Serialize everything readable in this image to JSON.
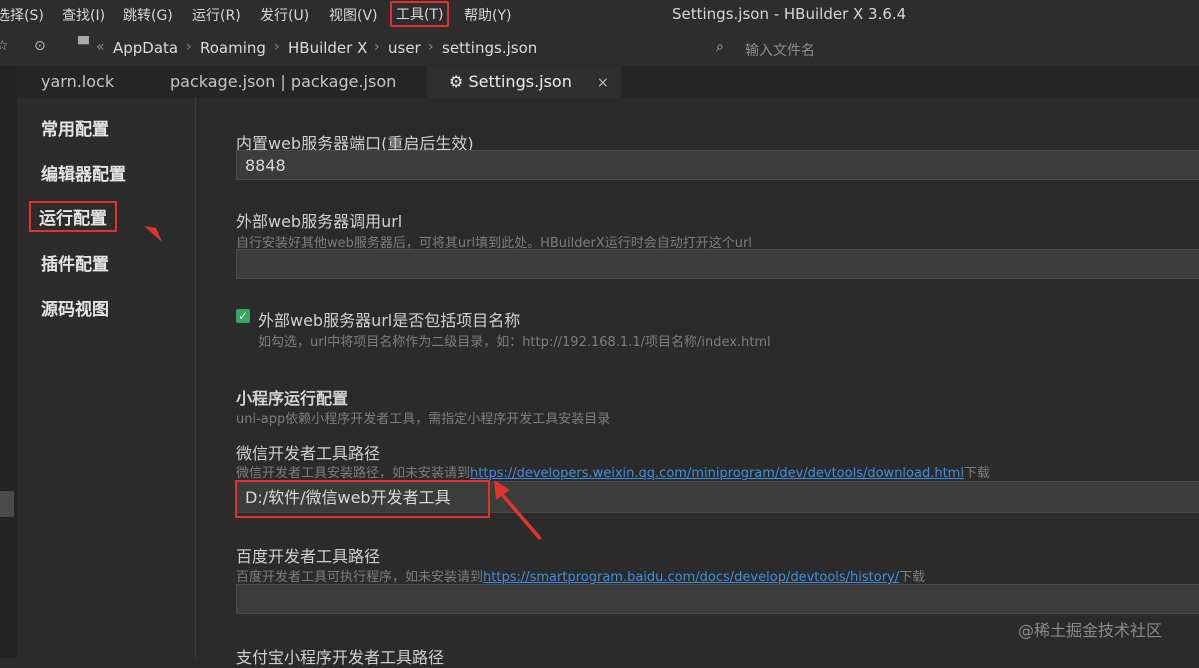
{
  "menubar": {
    "items": [
      "选择(S)",
      "查找(I)",
      "跳转(G)",
      "运行(R)",
      "发行(U)",
      "视图(V)",
      "工具(T)",
      "帮助(Y)"
    ],
    "window_title": "Settings.json - HBuilder X 3.6.4"
  },
  "toolbar": {
    "breadcrumb": [
      "AppData",
      "Roaming",
      "HBuilder X",
      "user",
      "settings.json"
    ],
    "file_search_placeholder": "输入文件名"
  },
  "tabs": [
    {
      "label": "yarn.lock",
      "active": false
    },
    {
      "label": "package.json | package.json",
      "active": false
    },
    {
      "label": "Settings.json",
      "active": true,
      "close": "×"
    }
  ],
  "sidebar": {
    "items": [
      "常用配置",
      "编辑器配置",
      "运行配置",
      "插件配置",
      "源码视图"
    ],
    "selected": "运行配置"
  },
  "settings": {
    "server_port": {
      "label": "内置web服务器端口(重启后生效)",
      "value": "8848"
    },
    "external_url": {
      "label": "外部web服务器调用url",
      "desc": "自行安装好其他web服务器后，可将其url填到此处。HBuilderX运行时会自动打开这个url",
      "value": ""
    },
    "include_project": {
      "label": "外部web服务器url是否包括项目名称",
      "desc": "如勾选，url中将项目名称作为二级目录，如：http://192.168.1.1/项目名称/index.html",
      "checked": true
    },
    "miniprogram": {
      "title": "小程序运行配置",
      "desc": "uni-app依赖小程序开发者工具，需指定小程序开发工具安装目录"
    },
    "wechat": {
      "label": "微信开发者工具路径",
      "desc_prefix": "微信开发者工具安装路径，如未安装请到",
      "link": "https://developers.weixin.qq.com/miniprogram/dev/devtools/download.html",
      "desc_suffix": "下载",
      "value": "D:/软件/微信web开发者工具"
    },
    "baidu": {
      "label": "百度开发者工具路径",
      "desc_prefix": "百度开发者工具可执行程序，如未安装请到",
      "link": "https://smartprogram.baidu.com/docs/develop/devtools/history/",
      "desc_suffix": "下载",
      "value": ""
    },
    "alipay": {
      "label": "支付宝小程序开发者工具路径"
    }
  },
  "watermark": "@稀土掘金技术社区",
  "colors": {
    "highlight": "#e0332d",
    "link": "#3f8fe0",
    "checkbox": "#3aa55d"
  }
}
